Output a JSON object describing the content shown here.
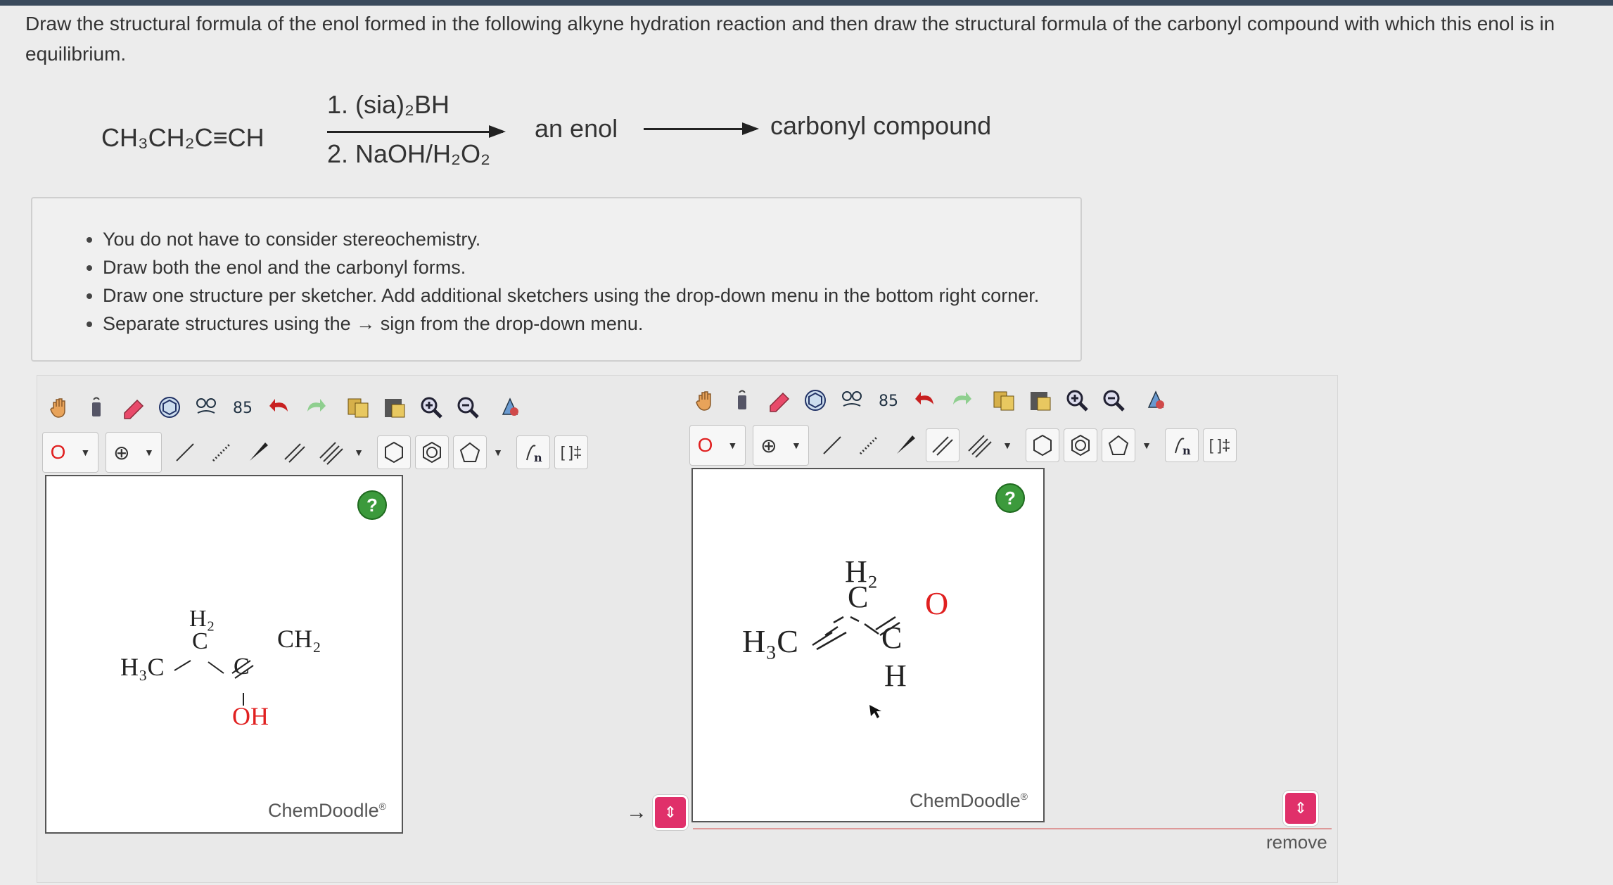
{
  "question": {
    "text": "Draw the structural formula of the enol formed in the following alkyne hydration reaction and then draw the structural formula of the carbonyl compound with which this enol is in equilibrium."
  },
  "reaction": {
    "reactant": "CH₃CH₂C≡CH",
    "reagent1": "1. (sia)₂BH",
    "reagent2": "2. NaOH/H₂O₂",
    "intermediate": "an enol",
    "product": "carbonyl compound"
  },
  "instructions": [
    "You do not have to consider stereochemistry.",
    "Draw both the enol and the carbonyl forms.",
    "Draw one structure per sketcher. Add additional sketchers using the drop-down menu in the bottom right corner.",
    "Separate structures using the → sign from the drop-down menu."
  ],
  "toolbar": {
    "atom_label": "O",
    "charge_label": "⊕",
    "template_label": "[ ]‡"
  },
  "sketcher1": {
    "brand": "ChemDoodle",
    "brand_mark": "®",
    "help": "?",
    "structure": {
      "h3c": "H₃C",
      "ch2_top": "H₂",
      "c1": "C",
      "c2": "C",
      "ch2_end": "CH₂",
      "oh": "OH"
    }
  },
  "sketcher2": {
    "brand": "ChemDoodle",
    "brand_mark": "®",
    "help": "?",
    "structure": {
      "h3c": "H₃C",
      "ch2_top": "H₂",
      "c1": "C",
      "c2": "C",
      "o": "O",
      "h": "H"
    }
  },
  "separator": {
    "symbol": "→",
    "control": "⇕"
  },
  "footer": {
    "remove_label": "remove",
    "control": "⇕"
  },
  "colors": {
    "oxygen": "#e02020",
    "help_green": "#3c9a3c",
    "accent_pink": "#e0306a"
  }
}
